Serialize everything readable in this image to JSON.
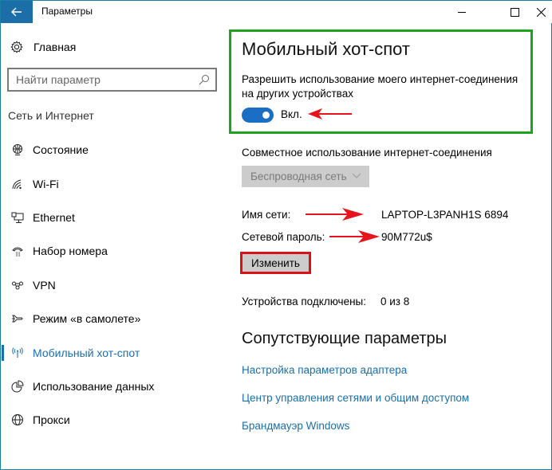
{
  "window": {
    "title": "Параметры",
    "controls": {
      "minimize": "minimize-icon",
      "maximize": "maximize-icon",
      "close": "close-icon"
    },
    "accent_color": "#1b6ea8"
  },
  "sidebar": {
    "home_label": "Главная",
    "search_placeholder": "Найти параметр",
    "section_title": "Сеть и Интернет",
    "items": [
      {
        "label": "Состояние",
        "icon": "status-globe-icon",
        "active": false
      },
      {
        "label": "Wi-Fi",
        "icon": "wifi-icon",
        "active": false
      },
      {
        "label": "Ethernet",
        "icon": "ethernet-icon",
        "active": false
      },
      {
        "label": "Набор номера",
        "icon": "dialup-phone-icon",
        "active": false
      },
      {
        "label": "VPN",
        "icon": "vpn-icon",
        "active": false
      },
      {
        "label": "Режим «в самолете»",
        "icon": "airplane-icon",
        "active": false
      },
      {
        "label": "Мобильный хот-спот",
        "icon": "hotspot-icon",
        "active": true
      },
      {
        "label": "Использование данных",
        "icon": "data-usage-icon",
        "active": false
      },
      {
        "label": "Прокси",
        "icon": "proxy-globe-icon",
        "active": false
      }
    ]
  },
  "main": {
    "title": "Мобильный хот-спот",
    "description": "Разрешить использование моего интернет-соединения на других устройствах",
    "toggle": {
      "state": "on",
      "label": "Вкл."
    },
    "share_label": "Совместное использование интернет-соединения",
    "share_dropdown_value": "Беспроводная сеть",
    "network_name_label": "Имя сети:",
    "network_name_value": "LAPTOP-L3PANH1S 6894",
    "password_label": "Сетевой пароль:",
    "password_value": "90M772u$",
    "edit_button": "Изменить",
    "devices_label": "Устройства подключены:",
    "devices_value": "0 из 8",
    "related_title": "Сопутствующие параметры",
    "related_links": [
      "Настройка параметров адаптера",
      "Центр управления сетями и общим доступом",
      "Брандмауэр Windows"
    ]
  },
  "annotations": {
    "highlight_box_color": "#1da31d",
    "button_highlight_color": "#d9121a",
    "arrow_color": "#e8141c"
  }
}
